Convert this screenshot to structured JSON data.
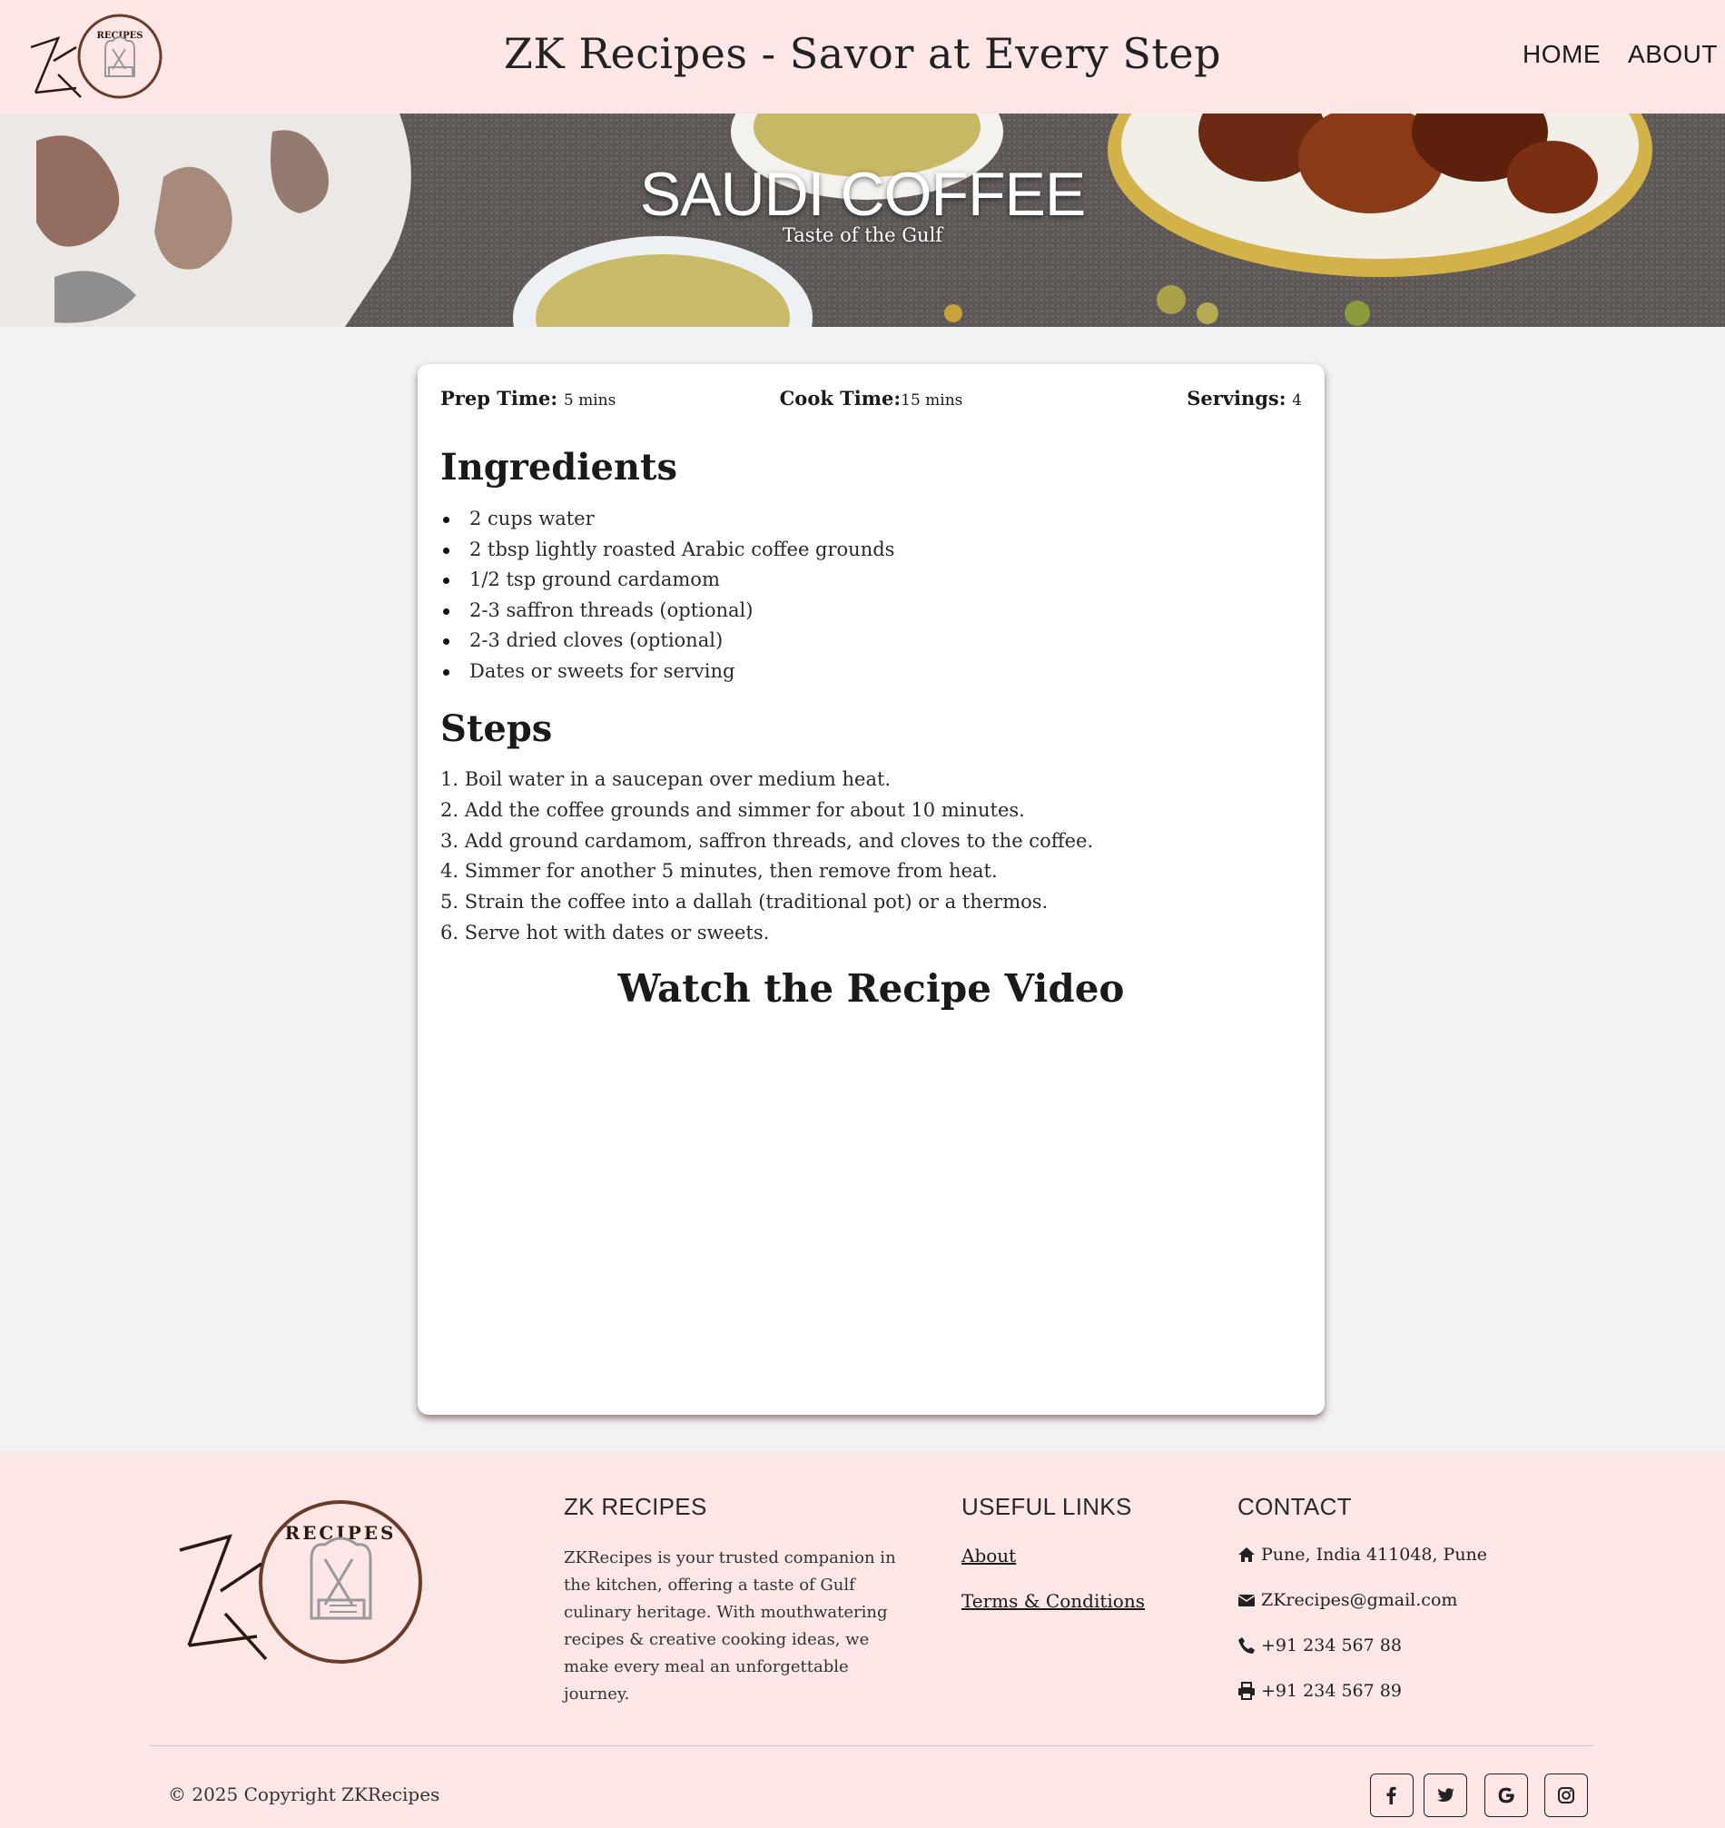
{
  "header": {
    "logo_text": "RECIPES",
    "title": "ZK Recipes - Savor at Every Step",
    "nav": [
      {
        "label": "HOME"
      },
      {
        "label": "ABOUT"
      }
    ]
  },
  "hero": {
    "title": "SAUDI COFFEE",
    "subtitle": "Taste of the Gulf"
  },
  "recipe": {
    "prep_label": "Prep Time:",
    "prep_value": "5 mins",
    "cook_label": "Cook Time:",
    "cook_value": "15 mins",
    "servings_label": "Servings:",
    "servings_value": "4",
    "ingredients_title": "Ingredients",
    "ingredients": [
      "2 cups water",
      "2 tbsp lightly roasted Arabic coffee grounds",
      "1/2 tsp ground cardamom",
      "2-3 saffron threads (optional)",
      "2-3 dried cloves (optional)",
      "Dates or sweets for serving"
    ],
    "steps_title": "Steps",
    "steps": [
      "1. Boil water in a saucepan over medium heat.",
      "2. Add the coffee grounds and simmer for about 10 minutes.",
      "3. Add ground cardamom, saffron threads, and cloves to the coffee.",
      "4. Simmer for another 5 minutes, then remove from heat.",
      "5. Strain the coffee into a dallah (traditional pot) or a thermos.",
      "6. Serve hot with dates or sweets."
    ],
    "video_title": "Watch the Recipe Video"
  },
  "footer": {
    "logo_text": "RECIPES",
    "about_title": "ZK RECIPES",
    "about_text": "ZKRecipes is your trusted companion in the kitchen, offering a taste of Gulf culinary heritage. With mouthwatering recipes & creative cooking ideas, we make every meal an unforgettable journey.",
    "links_title": "USEFUL LINKS",
    "links": [
      "About",
      "Terms & Conditions"
    ],
    "contact_title": "CONTACT",
    "contact": {
      "address": "Pune, India 411048, Pune",
      "email": "ZKrecipes@gmail.com",
      "phone": "+91 234 567 88",
      "fax": "+91 234 567 89"
    },
    "copyright": "© 2025 Copyright ZKRecipes",
    "social": [
      "facebook-icon",
      "twitter-icon",
      "google-icon",
      "instagram-icon"
    ]
  },
  "colors": {
    "header_bg": "#fde6e6",
    "page_bg": "#f2f2f2",
    "logo_brown": "#6b3b2a"
  }
}
